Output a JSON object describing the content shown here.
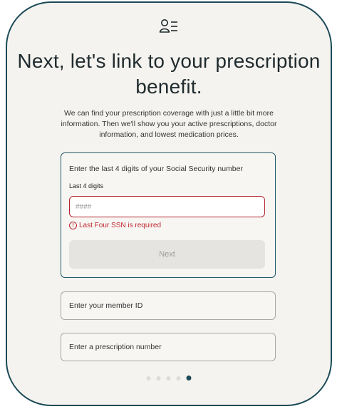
{
  "header": {
    "icon": "user-list-icon",
    "title": "Next, let's link to your prescription benefit.",
    "subtitle": "We can find your prescription coverage with just a little bit more information. Then we'll show you your active prescriptions, doctor information, and lowest medication prices."
  },
  "ssn_panel": {
    "instruction": "Enter the last 4 digits of your Social Security number",
    "label": "Last 4 digits",
    "input_value": "",
    "placeholder": "####",
    "error_text": "Last Four SSN is required",
    "next_label": "Next"
  },
  "options": {
    "member_id": "Enter your member ID",
    "prescription_number": "Enter a prescription number"
  },
  "pagination": {
    "total": 5,
    "active_index": 4
  },
  "colors": {
    "accent": "#1b4a57",
    "error": "#c0282f",
    "card_background": "#f5f3ef",
    "disabled_button": "#e6e4e1"
  }
}
